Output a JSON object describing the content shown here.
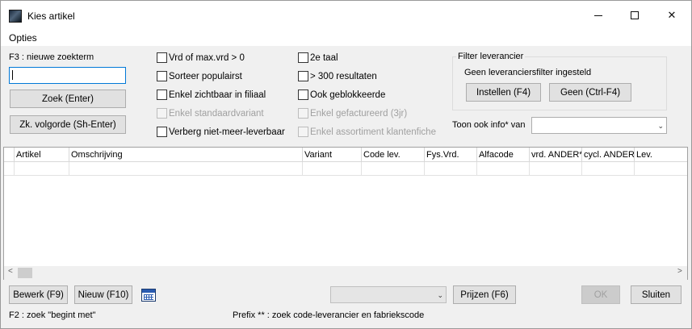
{
  "window": {
    "title": "Kies artikel",
    "controls": {
      "minimize": "minimize-icon",
      "maximize": "maximize-icon",
      "close": "close-icon",
      "close_glyph": "✕"
    }
  },
  "menu": {
    "items": [
      "Opties"
    ]
  },
  "search": {
    "label": "F3 : nieuwe zoekterm",
    "value": "",
    "search_button": "Zoek (Enter)",
    "order_button": "Zk. volgorde (Sh-Enter)"
  },
  "options_col1": [
    {
      "label": "Vrd of max.vrd > 0",
      "checked": false,
      "enabled": true
    },
    {
      "label": "Sorteer populairst",
      "checked": false,
      "enabled": true
    },
    {
      "label": "Enkel zichtbaar in filiaal",
      "checked": false,
      "enabled": true
    },
    {
      "label": "Enkel standaardvariant",
      "checked": false,
      "enabled": false
    },
    {
      "label": "Verberg niet-meer-leverbaar",
      "checked": false,
      "enabled": true
    }
  ],
  "options_col2": [
    {
      "label": "2e taal",
      "checked": false,
      "enabled": true
    },
    {
      "label": "> 300 resultaten",
      "checked": false,
      "enabled": true
    },
    {
      "label": "Ook geblokkeerde",
      "checked": false,
      "enabled": true
    },
    {
      "label": "Enkel gefactureerd (3jr)",
      "checked": false,
      "enabled": false
    },
    {
      "label": "Enkel assortiment klantenfiche",
      "checked": false,
      "enabled": false
    }
  ],
  "supplier_filter": {
    "group_title": "Filter leverancier",
    "status": "Geen leveranciersfilter ingesteld",
    "set_button": "Instellen (F4)",
    "none_button": "Geen (Ctrl-F4)"
  },
  "toon_info": {
    "label": "Toon ook info* van",
    "value": ""
  },
  "grid": {
    "columns": [
      "Artikel",
      "Omschrijving",
      "Variant",
      "Code lev.",
      "Fys.Vrd.",
      "Alfacode",
      "vrd. ANDER*",
      "cycl. ANDER*",
      "Lev."
    ],
    "rows": [
      [
        "",
        "",
        "",
        "",
        "",
        "",
        "",
        "",
        ""
      ]
    ]
  },
  "scroll": {
    "left_glyph": "<",
    "right_glyph": ">"
  },
  "footer": {
    "edit_button": "Bewerk (F9)",
    "new_button": "Nieuw (F10)",
    "calendar_icon": "calendar-icon",
    "combo_value": "",
    "prices_button": "Prijzen (F6)",
    "ok_button": "OK",
    "close_button": "Sluiten",
    "hint_left": "F2 : zoek \"begint met\"",
    "hint_right": "Prefix ** : zoek code-leverancier en fabriekscode"
  },
  "colors": {
    "focus_border": "#0078d7",
    "disabled_text": "#a0a0a0",
    "window_bg": "#f0f0f0"
  }
}
